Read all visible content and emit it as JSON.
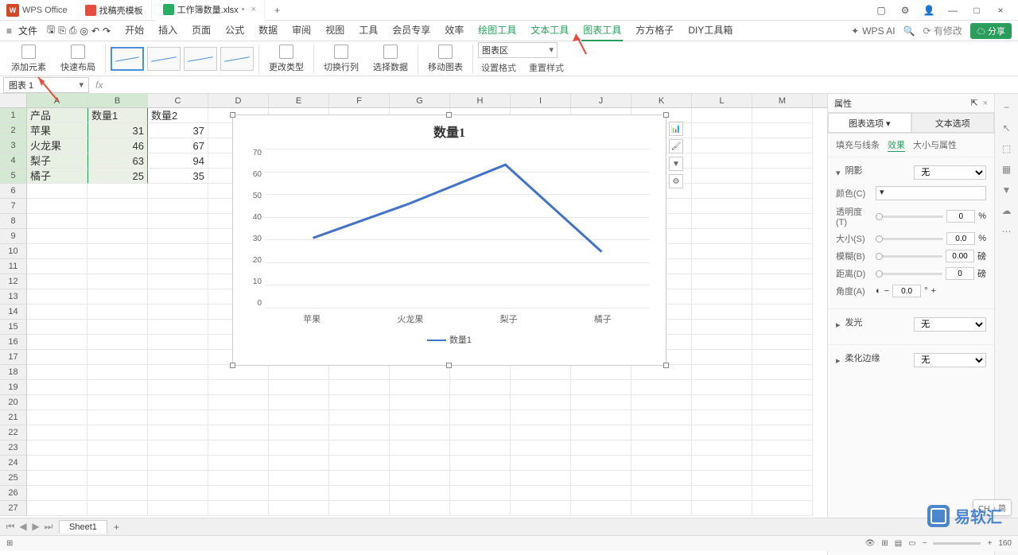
{
  "title_bar": {
    "app_name": "WPS Office",
    "tabs": [
      {
        "icon": "d",
        "label": "找稿壳模板"
      },
      {
        "icon": "s",
        "label": "工作簿数量.xlsx",
        "modified": "•"
      }
    ]
  },
  "menu_bar": {
    "file": "文件",
    "items": [
      "开始",
      "插入",
      "页面",
      "公式",
      "数据",
      "审阅",
      "视图",
      "工具",
      "会员专享",
      "效率"
    ],
    "green_items": [
      "绘图工具",
      "文本工具",
      "图表工具"
    ],
    "active": "图表工具",
    "extra": [
      "方方格子",
      "DIY工具箱"
    ],
    "wps_ai": "WPS AI",
    "modify": "有修改",
    "share": "分享"
  },
  "ribbon": {
    "add_element": "添加元素",
    "quick_layout": "快速布局",
    "change_type": "更改类型",
    "switch_rc": "切换行列",
    "select_data": "选择数据",
    "move_chart": "移动图表",
    "chart_area": "图表区",
    "set_format": "设置格式",
    "reset_style": "重置样式"
  },
  "name_box": "图表 1",
  "columns": [
    "A",
    "B",
    "C",
    "D",
    "E",
    "F",
    "G",
    "H",
    "I",
    "J",
    "K",
    "L",
    "M"
  ],
  "sheet_data": {
    "headers": [
      "产品",
      "数量1",
      "数量2"
    ],
    "rows": [
      {
        "product": "苹果",
        "q1": 31,
        "q2": 37
      },
      {
        "product": "火龙果",
        "q1": 46,
        "q2": 67
      },
      {
        "product": "梨子",
        "q1": 63,
        "q2": 94
      },
      {
        "product": "橘子",
        "q1": 25,
        "q2": 35
      }
    ]
  },
  "chart_data": {
    "type": "line",
    "title": "数量1",
    "categories": [
      "苹果",
      "火龙果",
      "梨子",
      "橘子"
    ],
    "series": [
      {
        "name": "数量1",
        "values": [
          31,
          46,
          63,
          25
        ]
      }
    ],
    "ylim": [
      0,
      70
    ],
    "yticks": [
      0,
      10,
      20,
      30,
      40,
      50,
      60,
      70
    ]
  },
  "right_panel": {
    "title": "属性",
    "tab1": "图表选项",
    "tab2": "文本选项",
    "subtabs": [
      "填充与线条",
      "效果",
      "大小与属性"
    ],
    "shadow": "阴影",
    "none": "无",
    "color": "颜色(C)",
    "transparency": "透明度(T)",
    "transparency_val": "0",
    "transparency_unit": "%",
    "size": "大小(S)",
    "size_val": "0.0",
    "size_unit": "%",
    "blur": "模糊(B)",
    "blur_val": "0.00",
    "blur_unit": "磅",
    "distance": "距离(D)",
    "distance_val": "0",
    "distance_unit": "磅",
    "angle": "角度(A)",
    "angle_val": "0.0",
    "angle_unit": "°",
    "glow": "发光",
    "soft_edge": "柔化边缘"
  },
  "sheet_tab": "Sheet1",
  "status": {
    "zoom": "160",
    "ime": "CH ♪ 简"
  },
  "watermark": "易软汇"
}
